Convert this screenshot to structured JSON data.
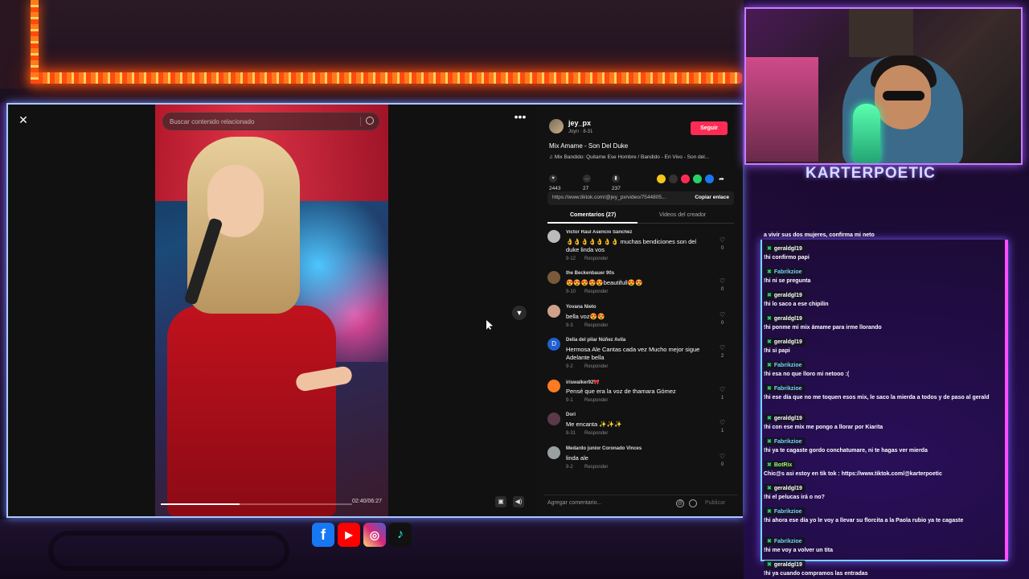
{
  "tiktok": {
    "search_placeholder": "Buscar contenido relacionado",
    "player": {
      "time": "02:40/06:27",
      "progress": 0.41
    },
    "author": {
      "name": "jey_px",
      "sub": "Joyrı · 8-31",
      "follow_label": "Seguir"
    },
    "description": "Mix Amame - Son Del Duke",
    "music": "Mix Bandido: Quitame Ese Hombre / Bandido - En Vivo - Son del...",
    "stats": {
      "likes": "2443",
      "comments": "27",
      "saves": "237"
    },
    "share_link": "https://www.tiktok.com/@jey_px/video/7544805...",
    "copy_link_label": "Copiar enlace",
    "tabs": {
      "comments": "Comentarios (27)",
      "creator_videos": "Videos del creador"
    },
    "reply_label": "Responder",
    "comments": [
      {
        "name": "Victor Raul Asencio Sánchez",
        "text": "👌👌👌👌👌👌👌 muchas bendiciones son del duke linda vos",
        "date": "9-12",
        "likes": "0"
      },
      {
        "name": "the Beckenbauer 90s",
        "text": "😍😍😍😍😍beautifull😍😍",
        "date": "9-10",
        "likes": "0"
      },
      {
        "name": "Yovana Nieto",
        "text": "bella voz😍😍",
        "date": "9-3",
        "likes": "0"
      },
      {
        "name": "Delia del pilar Núñez Avila",
        "text": "Hermosa Ale Cantas cada vez Mucho mejor sigue Adelante bella",
        "date": "9-2",
        "likes": "2"
      },
      {
        "name": "iriswalker92🎀",
        "text": "Pensé que era la voz de thamara Gómez",
        "date": "9-1",
        "likes": "1"
      },
      {
        "name": "Dori",
        "text": "Me encanta ✨✨✨",
        "date": "8-31",
        "likes": "1"
      },
      {
        "name": "Medardo junior Coronado Vinces",
        "text": "linda ale",
        "date": "9-2",
        "likes": "0"
      }
    ],
    "add_comment_placeholder": "Agregar comentario...",
    "publish_label": "Publicar"
  },
  "webcam": {
    "streamer_name": "KARTERPOETIC"
  },
  "chat": [
    {
      "user": "",
      "text": "a vivir sus dos mujeres, confirma mi neto"
    },
    {
      "user": "geraldgl19",
      "text": "!hi confirmo papi"
    },
    {
      "user": "Fabrikzioe",
      "text": "!hi ni se pregunta"
    },
    {
      "user": "geraldgl19",
      "text": "!hi lo saco a ese chipilin"
    },
    {
      "user": "geraldgl19",
      "text": "!hi ponme mi mix ámame para irme llorando"
    },
    {
      "user": "geraldgl19",
      "text": "!hi si papi"
    },
    {
      "user": "Fabrikzioe",
      "text": "!hi esa no que lloro mi netooo :("
    },
    {
      "user": "Fabrikzioe",
      "text": "!hi ese día que no me toquen esos mix, le saco la mierda a todos y de paso al gerald"
    },
    {
      "user": "geraldgl19",
      "text": "!hi con ese mix me pongo a llorar por Kiarita"
    },
    {
      "user": "Fabrikzioe",
      "text": "!hi ya te cagaste gordo conchatumare, ni te hagas ver mierda"
    },
    {
      "user": "BotRix",
      "text": "Chic@s asi estoy en tik tok : https://www.tiktok.com/@karterpoetic"
    },
    {
      "user": "geraldgl19",
      "text": "!hi el pelucas irá o no?"
    },
    {
      "user": "Fabrikzioe",
      "text": "!hi ahora ese día yo le voy a llevar su florcita a la Paola rubio ya te cagaste"
    },
    {
      "user": "Fabrikzioe",
      "text": "!hi me voy a volver un tita"
    },
    {
      "user": "geraldgl19",
      "text": "!hi ya cuando compramos las entradas"
    }
  ],
  "colors": {
    "follow": "#fe2c55",
    "chat_border_left": "#6fd8ff",
    "chat_border_right": "#ff4dff",
    "led": "#ff7a1a"
  }
}
